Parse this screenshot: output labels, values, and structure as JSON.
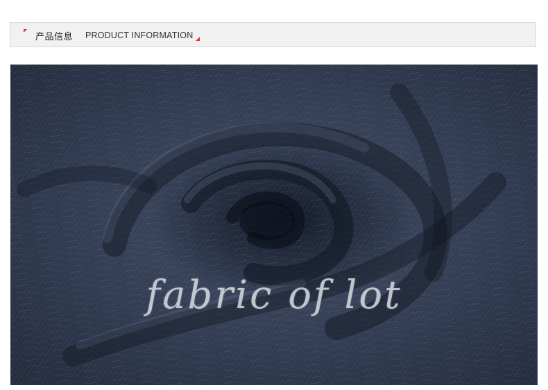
{
  "header": {
    "title_cn": "产品信息",
    "title_en": "PRODUCT INFORMATION",
    "accent_color": "#e0303a",
    "background_color": "#f1f1f1"
  },
  "photo": {
    "subject": "denim-fabric-swirl",
    "dominant_color": "#2b3447",
    "watermark_text": "fabric of lot"
  }
}
